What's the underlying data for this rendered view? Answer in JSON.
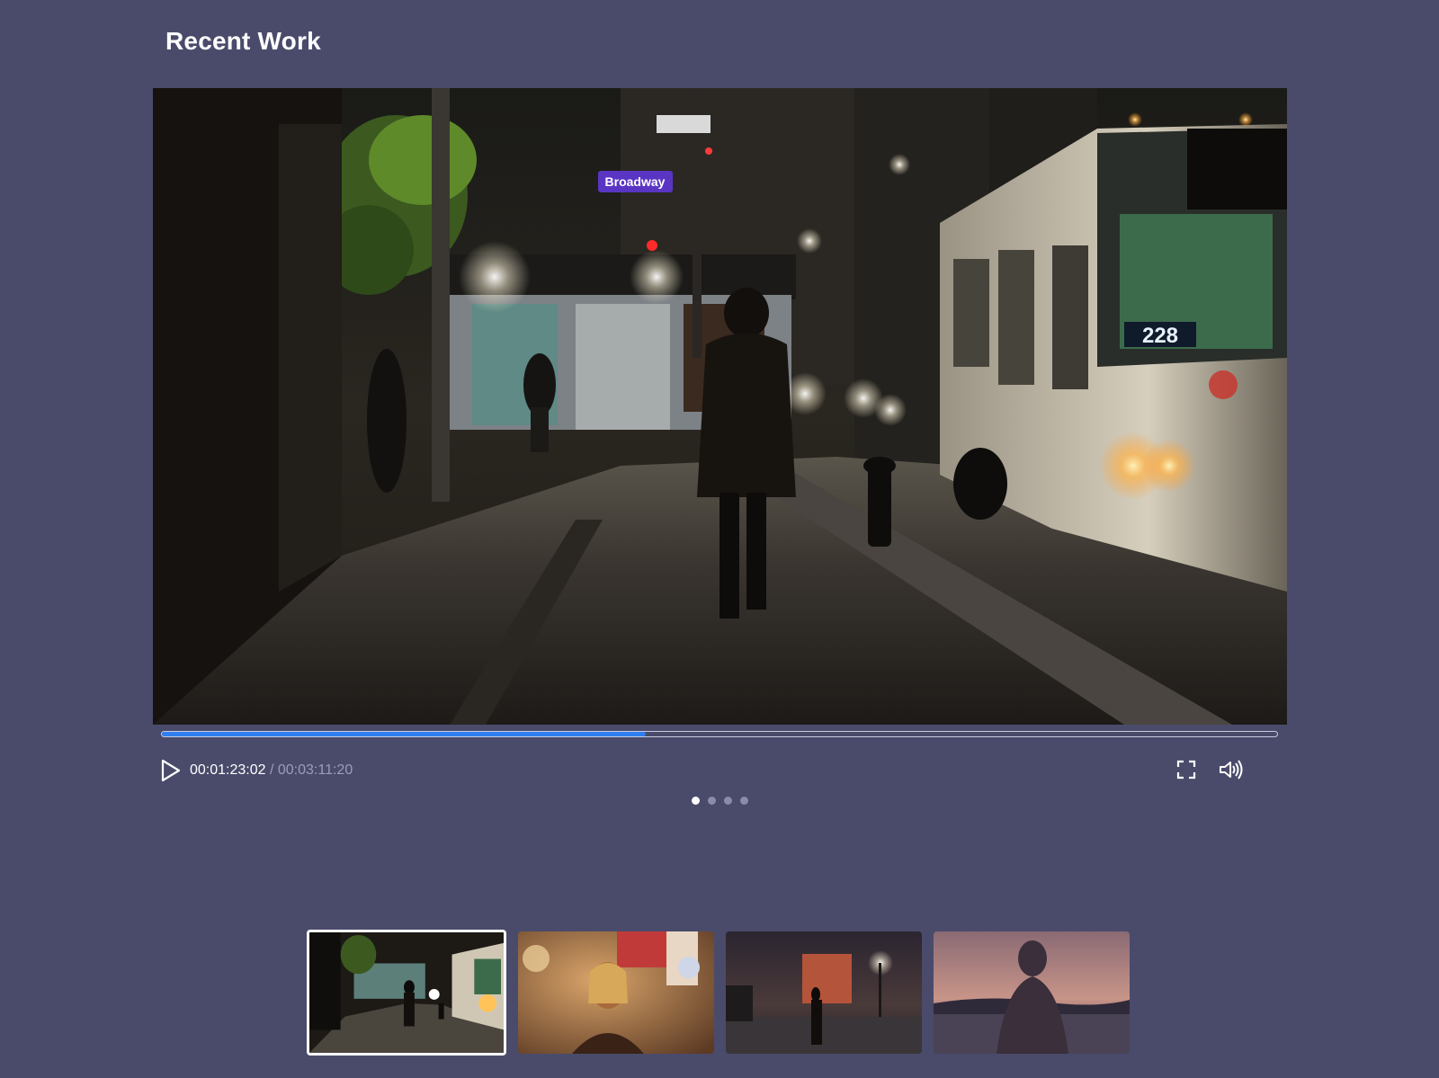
{
  "page": {
    "title": "Recent Work"
  },
  "player": {
    "progress_fraction": 0.434,
    "current_time": "00:01:23:02",
    "separator": " / ",
    "total_time": "00:03:11:20",
    "icons": [
      "play-icon",
      "fullscreen-icon",
      "volume-icon"
    ],
    "scene_signs": {
      "street_sign": "Broadway",
      "bus_number": "228"
    },
    "accent_color": "#2f7ff0"
  },
  "pagination": {
    "count": 4,
    "active_index": 0
  },
  "thumbnails": [
    {
      "id": "night-street",
      "active": true
    },
    {
      "id": "warm-portrait",
      "active": false
    },
    {
      "id": "foggy-plaza",
      "active": false
    },
    {
      "id": "sunset-silhouette",
      "active": false
    }
  ],
  "colors": {
    "background": "#4a4b6b",
    "text": "#ffffff",
    "muted_text": "#9a9cb8"
  }
}
